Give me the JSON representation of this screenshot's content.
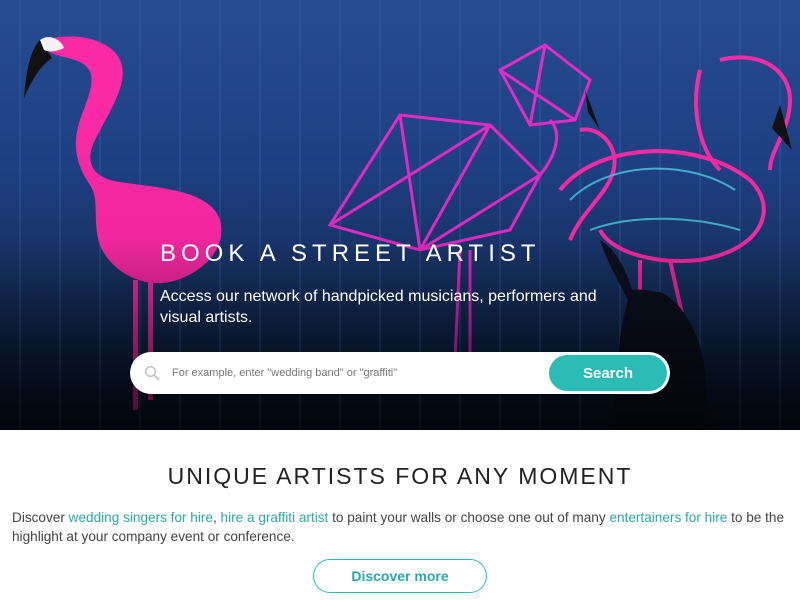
{
  "hero": {
    "title": "BOOK A STREET ARTIST",
    "subtitle": "Access our network of handpicked musicians, performers and visual artists."
  },
  "search": {
    "placeholder": "For example, enter \"wedding band\" or \"graffiti\"",
    "button_label": "Search",
    "icon": "search-icon"
  },
  "section": {
    "title": "UNIQUE ARTISTS FOR ANY MOMENT",
    "text_1": "Discover ",
    "link_1": "wedding singers for hire",
    "text_2": ", ",
    "link_2": "hire a graffiti artist",
    "text_3": " to paint your walls or choose one out of many ",
    "link_3": "entertainers for hire",
    "text_4": " to be the highlight at your company event or conference.",
    "button_label": "Discover more"
  },
  "colors": {
    "accent": "#2bbcb6",
    "link": "#2aa9a8",
    "hero_blue": "#1f4287",
    "flamingo_pink": "#ff2aa8"
  }
}
